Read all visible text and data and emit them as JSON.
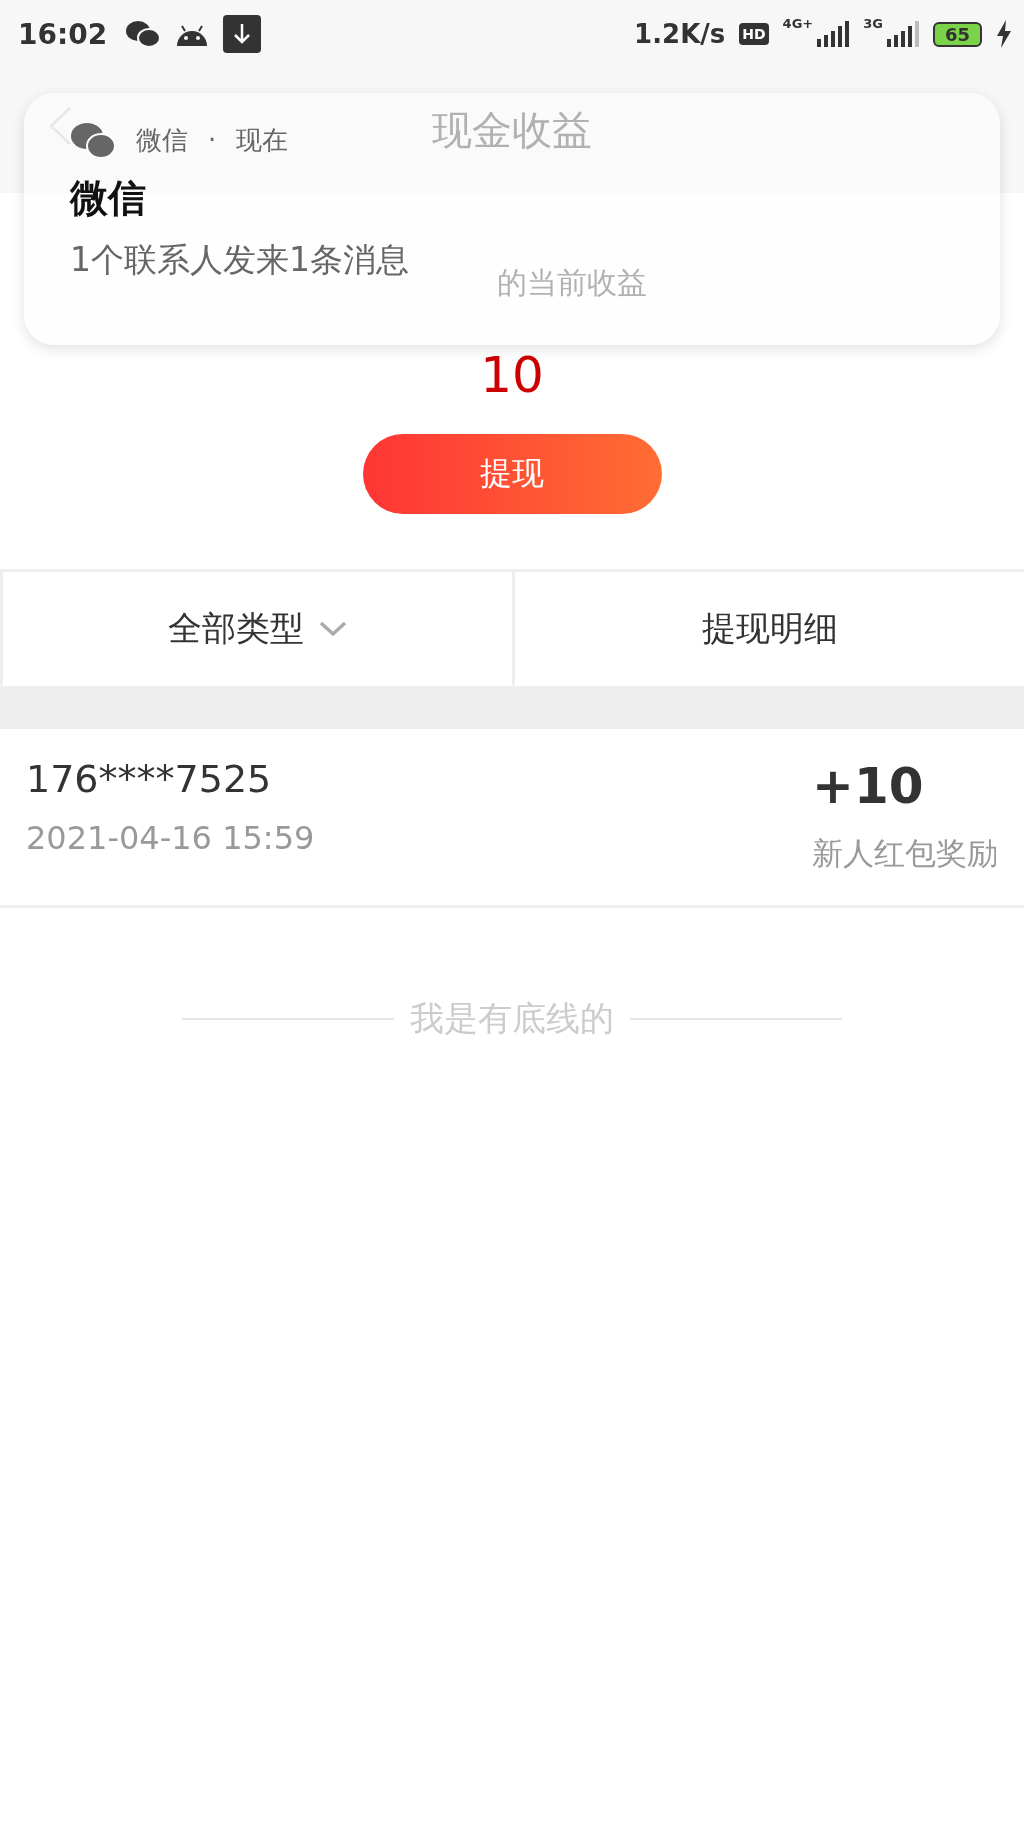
{
  "status_bar": {
    "time": "16:02",
    "speed": "1.2K/s",
    "hd": "HD",
    "network_1": "4G+",
    "network_2": "3G",
    "battery": "65"
  },
  "header": {
    "title": "现金收益"
  },
  "notification": {
    "app": "微信",
    "separator": "·",
    "time": "现在",
    "title": "微信",
    "message": "1个联系人发来1条消息"
  },
  "balance": {
    "subtitle": "的当前收益",
    "amount": "10",
    "button": "提现"
  },
  "tabs": [
    {
      "label": "全部类型",
      "kind": "dropdown"
    },
    {
      "label": "提现明细",
      "kind": "plain"
    }
  ],
  "records": [
    {
      "account": "176****7525",
      "time": "2021-04-16 15:59",
      "amount": "+10",
      "description": "新人红包奖励"
    }
  ],
  "footer": "我是有底线的"
}
